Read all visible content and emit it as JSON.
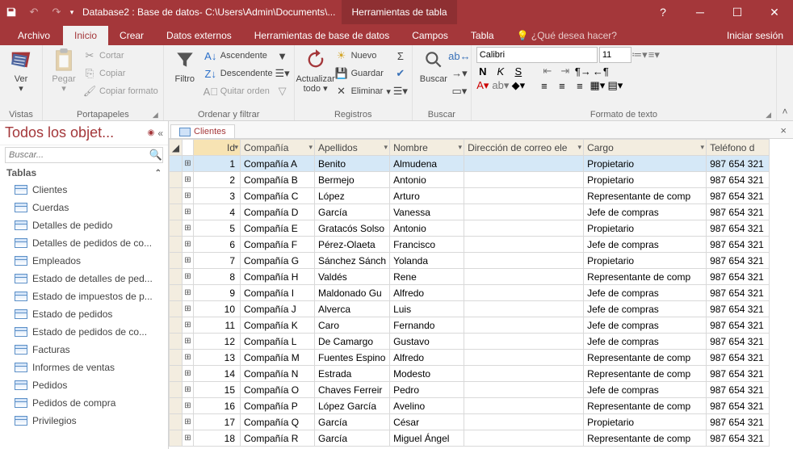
{
  "titlebar": {
    "title": "Database2 : Base de datos- C:\\Users\\Admin\\Documents\\...",
    "contextual": "Herramientas de tabla",
    "help": "?"
  },
  "ribbon_tabs": {
    "file": "Archivo",
    "home": "Inicio",
    "create": "Crear",
    "external": "Datos externos",
    "dbtools": "Herramientas de base de datos",
    "fields": "Campos",
    "table": "Tabla",
    "tell_me": "¿Qué desea hacer?",
    "signin": "Iniciar sesión"
  },
  "ribbon": {
    "views": {
      "btn": "Ver",
      "label": "Vistas"
    },
    "clipboard": {
      "paste": "Pegar",
      "cut": "Cortar",
      "copy": "Copiar",
      "painter": "Copiar formato",
      "label": "Portapapeles"
    },
    "sort": {
      "filter": "Filtro",
      "asc": "Ascendente",
      "desc": "Descendente",
      "clear": "Quitar orden",
      "label": "Ordenar y filtrar"
    },
    "records": {
      "refresh": "Actualizar todo",
      "new": "Nuevo",
      "save": "Guardar",
      "delete": "Eliminar",
      "label": "Registros"
    },
    "find": {
      "find": "Buscar",
      "label": "Buscar"
    },
    "font": {
      "font_name": "Calibri",
      "font_size": "11",
      "label": "Formato de texto",
      "bold": "N",
      "italic": "K",
      "underline": "S"
    }
  },
  "nav": {
    "title": "Todos los objet...",
    "search_placeholder": "Buscar...",
    "section": "Tablas",
    "items": [
      "Clientes",
      "Cuerdas",
      "Detalles de pedido",
      "Detalles de pedidos de co...",
      "Empleados",
      "Estado de detalles de ped...",
      "Estado de impuestos de p...",
      "Estado de pedidos",
      "Estado de pedidos de co...",
      "Facturas",
      "Informes de ventas",
      "Pedidos",
      "Pedidos de compra",
      "Privilegios"
    ]
  },
  "doc_tab": "Clientes",
  "columns": {
    "id": "Id",
    "comp": "Compañía",
    "ap": "Apellidos",
    "nom": "Nombre",
    "email": "Dirección de correo ele",
    "cargo": "Cargo",
    "tel": "Teléfono d"
  },
  "rows": [
    {
      "id": "1",
      "comp": "Compañía A",
      "ap": "Benito",
      "nom": "Almudena",
      "email": "",
      "cargo": "Propietario",
      "tel": "987 654 321"
    },
    {
      "id": "2",
      "comp": "Compañía B",
      "ap": "Bermejo",
      "nom": "Antonio",
      "email": "",
      "cargo": "Propietario",
      "tel": "987 654 321"
    },
    {
      "id": "3",
      "comp": "Compañía C",
      "ap": "López",
      "nom": "Arturo",
      "email": "",
      "cargo": "Representante de comp",
      "tel": "987 654 321"
    },
    {
      "id": "4",
      "comp": "Compañía D",
      "ap": "García",
      "nom": "Vanessa",
      "email": "",
      "cargo": "Jefe de compras",
      "tel": "987 654 321"
    },
    {
      "id": "5",
      "comp": "Compañía E",
      "ap": "Gratacós Solso",
      "nom": "Antonio",
      "email": "",
      "cargo": "Propietario",
      "tel": "987 654 321"
    },
    {
      "id": "6",
      "comp": "Compañía F",
      "ap": "Pérez-Olaeta",
      "nom": "Francisco",
      "email": "",
      "cargo": "Jefe de compras",
      "tel": "987 654 321"
    },
    {
      "id": "7",
      "comp": "Compañía G",
      "ap": "Sánchez Sánch",
      "nom": "Yolanda",
      "email": "",
      "cargo": "Propietario",
      "tel": "987 654 321"
    },
    {
      "id": "8",
      "comp": "Compañía H",
      "ap": "Valdés",
      "nom": "Rene",
      "email": "",
      "cargo": "Representante de comp",
      "tel": "987 654 321"
    },
    {
      "id": "9",
      "comp": "Compañía I",
      "ap": "Maldonado Gu",
      "nom": "Alfredo",
      "email": "",
      "cargo": "Jefe de compras",
      "tel": "987 654 321"
    },
    {
      "id": "10",
      "comp": "Compañía J",
      "ap": "Alverca",
      "nom": "Luis",
      "email": "",
      "cargo": "Jefe de compras",
      "tel": "987 654 321"
    },
    {
      "id": "11",
      "comp": "Compañía K",
      "ap": "Caro",
      "nom": "Fernando",
      "email": "",
      "cargo": "Jefe de compras",
      "tel": "987 654 321"
    },
    {
      "id": "12",
      "comp": "Compañía L",
      "ap": "De Camargo",
      "nom": "Gustavo",
      "email": "",
      "cargo": "Jefe de compras",
      "tel": "987 654 321"
    },
    {
      "id": "13",
      "comp": "Compañía M",
      "ap": "Fuentes Espino",
      "nom": "Alfredo",
      "email": "",
      "cargo": "Representante de comp",
      "tel": "987 654 321"
    },
    {
      "id": "14",
      "comp": "Compañía N",
      "ap": "Estrada",
      "nom": "Modesto",
      "email": "",
      "cargo": "Representante de comp",
      "tel": "987 654 321"
    },
    {
      "id": "15",
      "comp": "Compañía O",
      "ap": "Chaves Ferreir",
      "nom": "Pedro",
      "email": "",
      "cargo": "Jefe de compras",
      "tel": "987 654 321"
    },
    {
      "id": "16",
      "comp": "Compañía P",
      "ap": "López García",
      "nom": "Avelino",
      "email": "",
      "cargo": "Representante de comp",
      "tel": "987 654 321"
    },
    {
      "id": "17",
      "comp": "Compañía Q",
      "ap": "García",
      "nom": "César",
      "email": "",
      "cargo": "Propietario",
      "tel": "987 654 321"
    },
    {
      "id": "18",
      "comp": "Compañía R",
      "ap": "García",
      "nom": "Miguel Ángel",
      "email": "",
      "cargo": "Representante de comp",
      "tel": "987 654 321"
    }
  ]
}
